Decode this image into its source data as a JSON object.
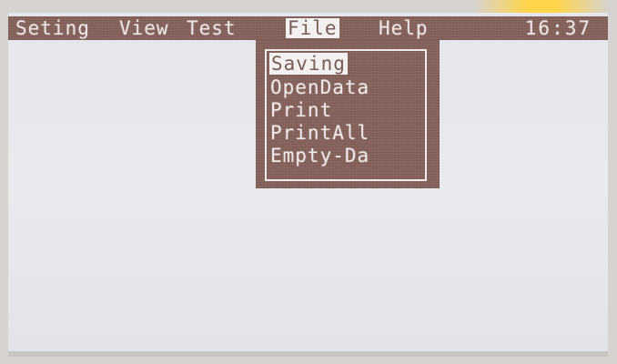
{
  "menubar": {
    "items": [
      {
        "label": "Seting"
      },
      {
        "label": "View"
      },
      {
        "label": "Test"
      },
      {
        "label": "File"
      },
      {
        "label": "Help"
      }
    ],
    "selected": "File",
    "clock": "16:37"
  },
  "dropdown": {
    "items": [
      {
        "label": "Saving"
      },
      {
        "label": "OpenData"
      },
      {
        "label": "Print"
      },
      {
        "label": "PrintAll"
      },
      {
        "label": "Empty-Da"
      }
    ],
    "selected": "Saving"
  },
  "colors": {
    "menubar_bg": "#8a6660",
    "screen_bg": "#e6e8eb",
    "menu_text": "#e9e4e2",
    "highlight_bg": "#f3f1f0",
    "accent_glow": "#ffd54a"
  }
}
